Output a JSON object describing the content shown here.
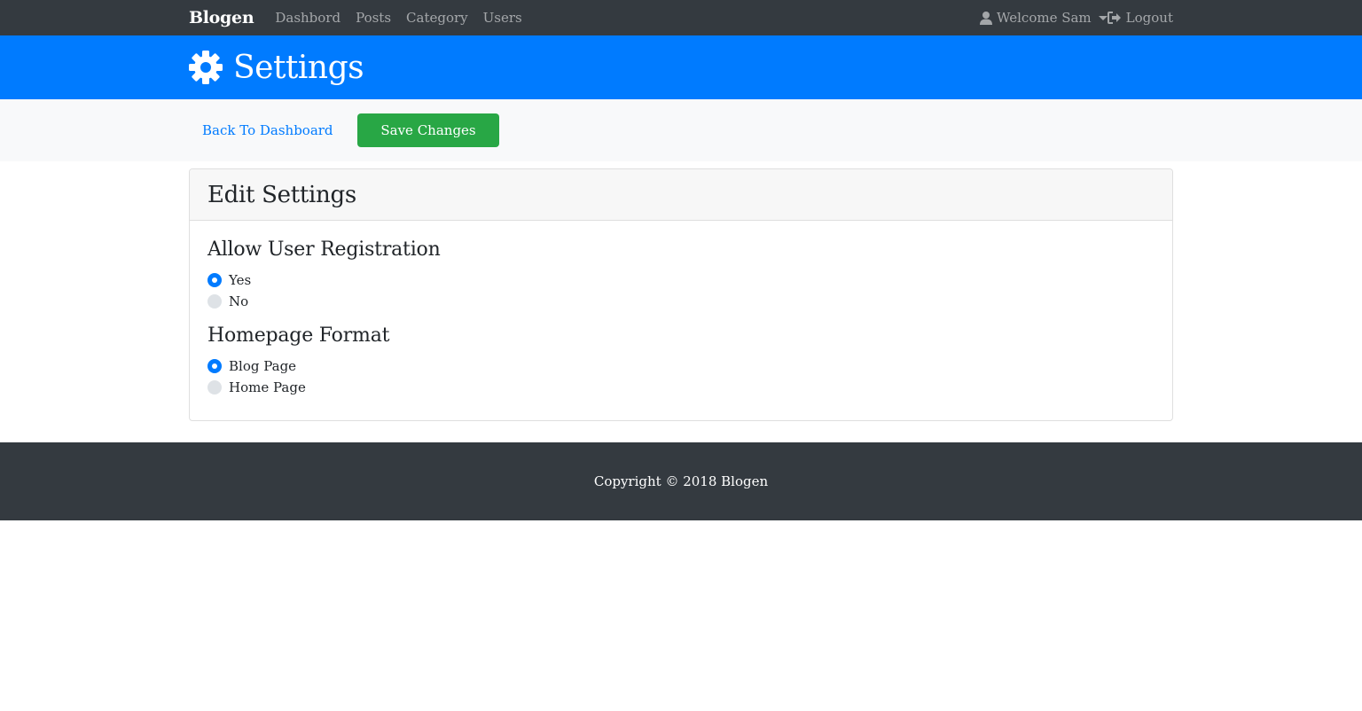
{
  "nav": {
    "brand": "Blogen",
    "links": [
      "Dashbord",
      "Posts",
      "Category",
      "Users"
    ],
    "user_menu": "Welcome Sam",
    "logout": "Logout"
  },
  "header": {
    "title": "Settings",
    "icon": "gear-icon"
  },
  "actions": {
    "back_label": "Back To Dashboard",
    "save_label": "Save Changes"
  },
  "card": {
    "title": "Edit Settings",
    "groups": [
      {
        "title": "Allow User Registration",
        "options": [
          {
            "label": "Yes",
            "checked": true
          },
          {
            "label": "No",
            "checked": false
          }
        ]
      },
      {
        "title": "Homepage Format",
        "options": [
          {
            "label": "Blog Page",
            "checked": true
          },
          {
            "label": "Home Page",
            "checked": false
          }
        ]
      }
    ]
  },
  "footer": {
    "copyright": "Copyright © 2018 Blogen"
  },
  "colors": {
    "navbar": "#343a40",
    "primary": "#007bff",
    "success": "#28a745",
    "light": "#f8f9fa"
  }
}
